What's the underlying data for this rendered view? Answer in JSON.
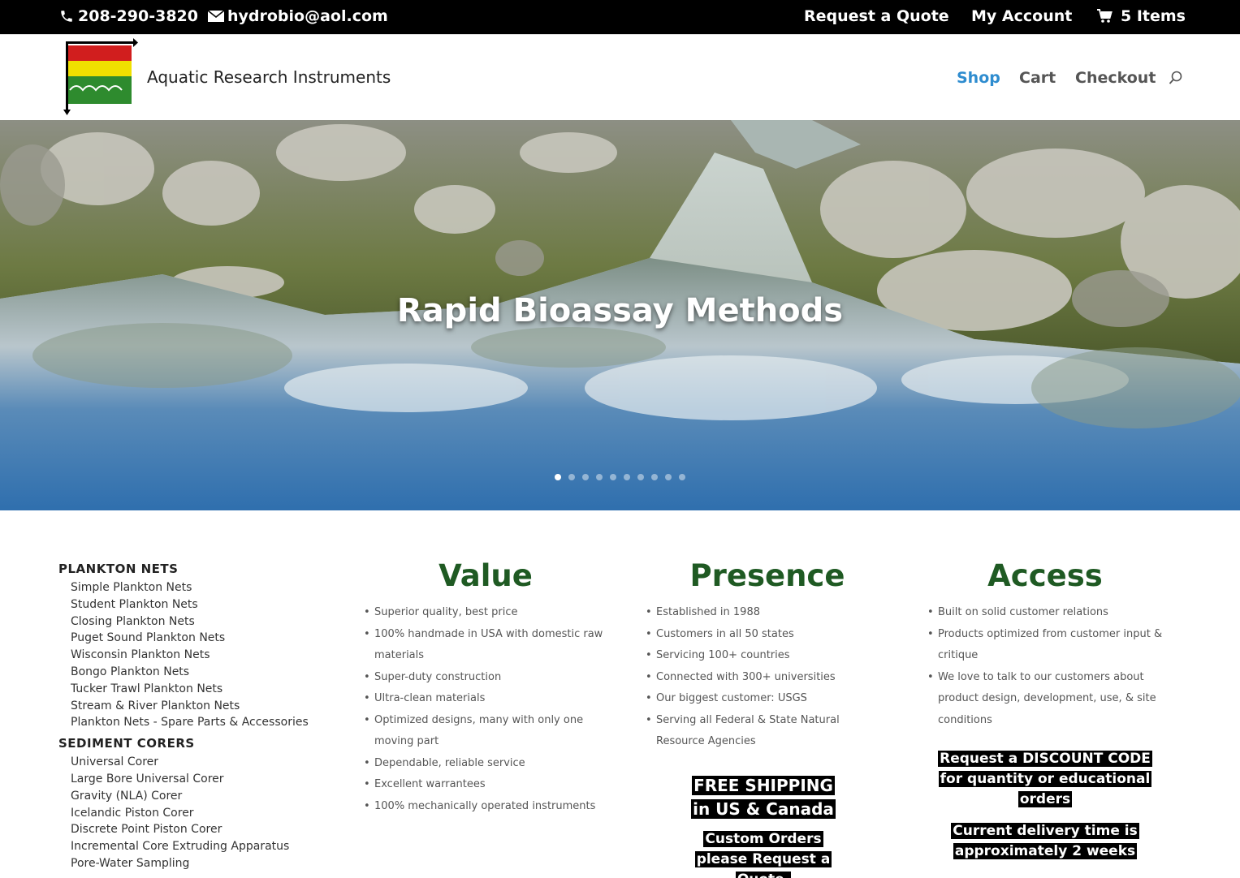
{
  "topbar": {
    "phone": "208-290-3820",
    "email": "hydrobio@aol.com",
    "request_quote": "Request a Quote",
    "my_account": "My Account",
    "cart_items": "5 Items"
  },
  "header": {
    "site_title": "Aquatic Research Instruments",
    "nav": [
      {
        "label": "Shop",
        "active": true
      },
      {
        "label": "Cart",
        "active": false
      },
      {
        "label": "Checkout",
        "active": false
      }
    ]
  },
  "hero": {
    "title": "Rapid Bioassay Methods",
    "slide_count": 10,
    "active_slide": 1
  },
  "sidebar": {
    "categories": [
      {
        "title": "PLANKTON NETS",
        "items": [
          "Simple Plankton Nets",
          "Student Plankton Nets",
          "Closing Plankton Nets",
          "Puget Sound Plankton Nets",
          "Wisconsin Plankton Nets",
          "Bongo Plankton Nets",
          "Tucker Trawl Plankton Nets",
          "Stream & River Plankton Nets",
          "Plankton Nets - Spare Parts & Accessories"
        ]
      },
      {
        "title": "SEDIMENT CORERS",
        "items": [
          "Universal Corer",
          "Large Bore Universal Corer",
          "Gravity (NLA) Corer",
          "Icelandic Piston Corer",
          "Discrete Point Piston Corer",
          "Incremental Core Extruding Apparatus",
          "Pore-Water Sampling"
        ]
      }
    ]
  },
  "columns": {
    "value": {
      "title": "Value",
      "items": [
        "Superior quality, best price",
        "100% handmade in USA with domestic raw materials",
        "Super-duty construction",
        "Ultra-clean materials",
        "Optimized designs, many with only one moving part",
        "Dependable, reliable service",
        "Excellent warrantees",
        "100% mechanically operated instruments"
      ]
    },
    "presence": {
      "title": "Presence",
      "items": [
        "Established in 1988",
        "Customers in all 50 states",
        "Servicing 100+ countries",
        "Connected with 300+ universities",
        "Our biggest customer: USGS",
        "Serving all Federal & State Natural Resource Agencies"
      ],
      "callout_shipping": "FREE SHIPPING in US & Canada",
      "callout_custom": "Custom Orders please Request a Quote."
    },
    "access": {
      "title": "Access",
      "items": [
        "Built on solid customer relations",
        "Products optimized from customer input & critique",
        "We love to talk to our customers about product design, development, use, & site conditions"
      ],
      "callout_discount": "Request a DISCOUNT CODE for quantity or educational orders",
      "callout_delivery": "Current delivery time is approximately 2 weeks"
    }
  },
  "colors": {
    "accent_blue": "#2e8ccf",
    "heading_green": "#1f5a23",
    "topbar_bg": "#000000"
  }
}
